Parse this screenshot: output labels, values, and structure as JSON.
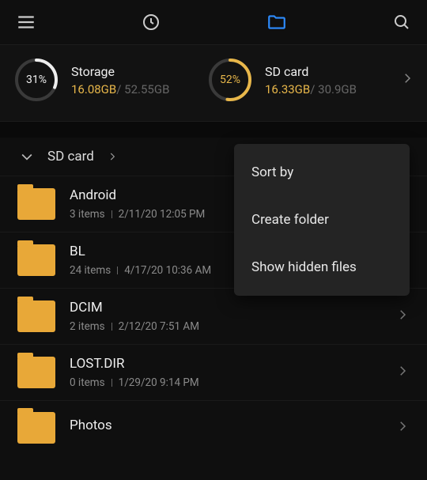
{
  "storage": [
    {
      "label": "Storage",
      "percent": "31%",
      "percent_num": 31,
      "used": "16.08GB",
      "total": "52.55GB",
      "ring_style": "white"
    },
    {
      "label": "SD card",
      "percent": "52%",
      "percent_num": 52,
      "used": "16.33GB",
      "total": "30.9GB",
      "ring_style": "gold"
    }
  ],
  "breadcrumb": {
    "label": "SD card"
  },
  "rows": [
    {
      "name": "Android",
      "count": "3 items",
      "date": "2/11/20 12:05 PM"
    },
    {
      "name": "BL",
      "count": "24 items",
      "date": "4/17/20 10:36 AM"
    },
    {
      "name": "DCIM",
      "count": "2 items",
      "date": "2/12/20 7:51 AM"
    },
    {
      "name": "LOST.DIR",
      "count": "0 items",
      "date": "1/29/20 9:14 PM"
    },
    {
      "name": "Photos",
      "count": "",
      "date": ""
    }
  ],
  "menu": [
    "Sort by",
    "Create folder",
    "Show hidden files"
  ]
}
